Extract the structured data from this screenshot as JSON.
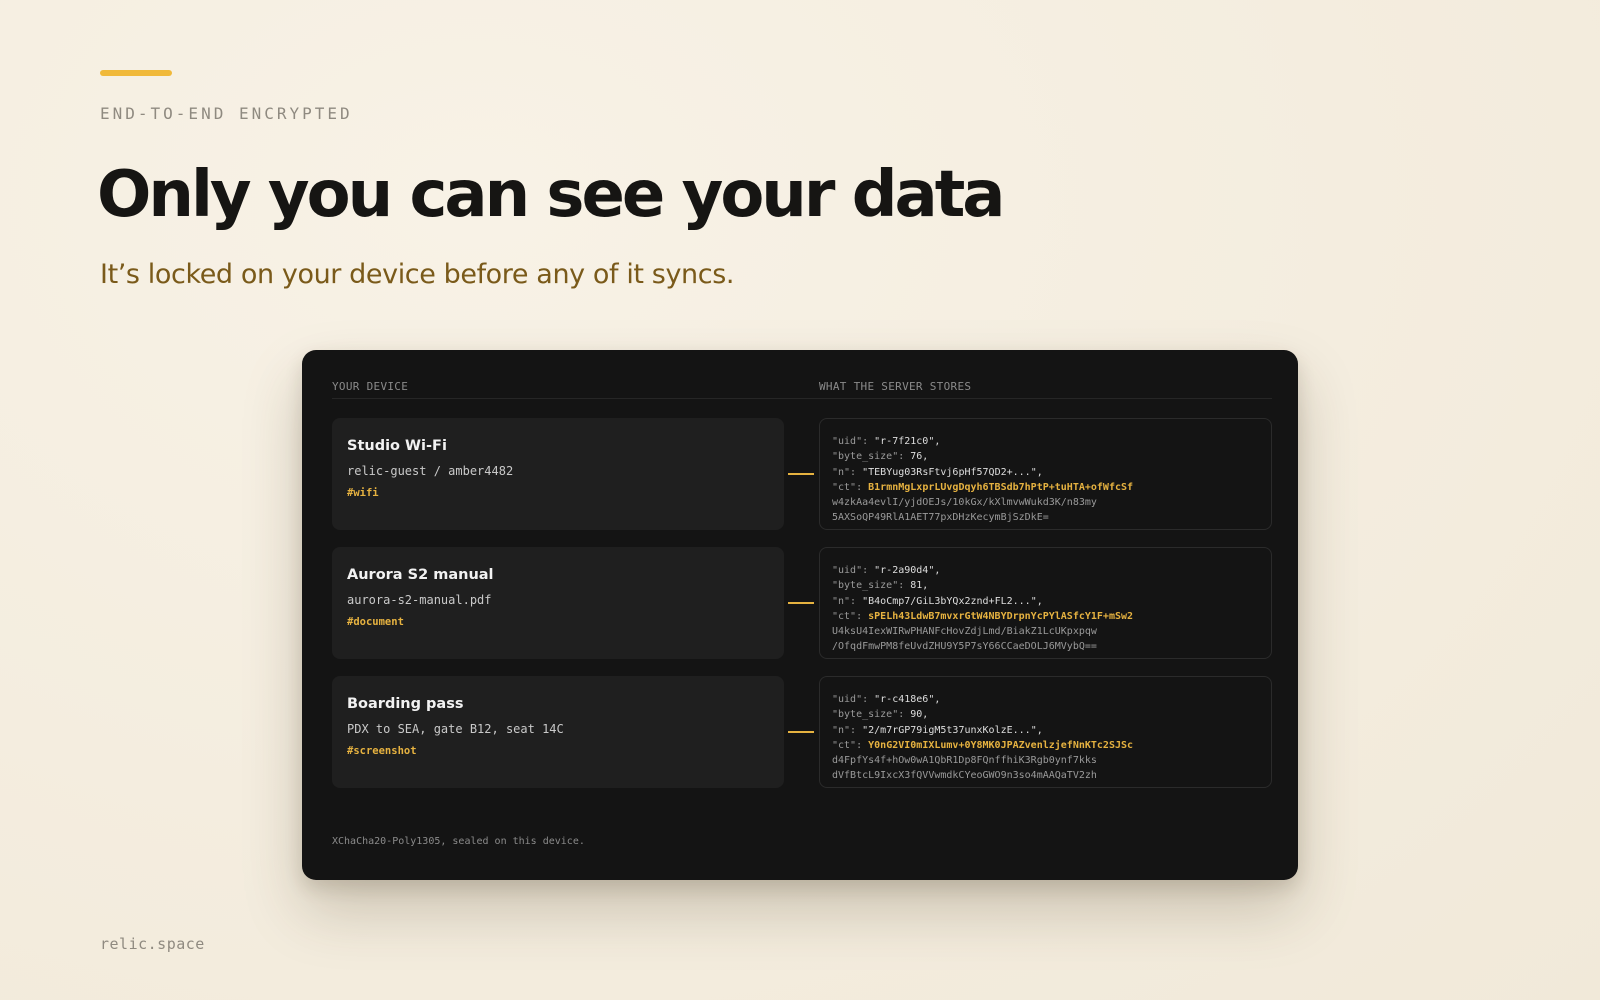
{
  "hero": {
    "eyebrow": "END-TO-END ENCRYPTED",
    "title": "Only you can see your data",
    "subtitle": "It’s locked on your device before any of it syncs."
  },
  "panel": {
    "device_header": "YOUR DEVICE",
    "server_header": "WHAT THE SERVER STORES",
    "footnote": "XChaCha20-Poly1305, sealed on this device."
  },
  "items": [
    {
      "title": "Studio Wi-Fi",
      "detail": "relic-guest / amber4482",
      "tag": "#wifi",
      "server": {
        "uid_key": "\"uid\":",
        "uid_val": " \"r-7f21c0\",",
        "size_key": "\"byte_size\":",
        "size_val": " 76,",
        "n_key": "\"n\":",
        "n_val": " \"TEBYug03RsFtvj6pHf57QD2+...\",",
        "ct_key": "\"ct\":",
        "ct_val": " B1rmnMgLxprLUvgDqyh6TBSdb7hPtP+tuHTA+ofWfcSf",
        "ct_line2": "w4zkAa4evlI/yjdOEJs/10kGx/kXlmvwWukd3K/n83my",
        "ct_line3": "5AXSoQP49RlA1AET77pxDHzKecymBjSzDkE="
      }
    },
    {
      "title": "Aurora S2 manual",
      "detail": "aurora-s2-manual.pdf",
      "tag": "#document",
      "server": {
        "uid_key": "\"uid\":",
        "uid_val": " \"r-2a90d4\",",
        "size_key": "\"byte_size\":",
        "size_val": " 81,",
        "n_key": "\"n\":",
        "n_val": " \"B4oCmp7/GiL3bYQx2znd+FL2...\",",
        "ct_key": "\"ct\":",
        "ct_val": " sPELh43LdwB7mvxrGtW4NBYDrpnYcPYlASfcY1F+mSw2",
        "ct_line2": "U4ksU4IexWIRwPHANFcHovZdjLmd/BiakZ1LcUKpxpqw",
        "ct_line3": "/OfqdFmwPM8feUvdZHU9Y5P7sY66CCaeDOLJ6MVybQ=="
      }
    },
    {
      "title": "Boarding pass",
      "detail": "PDX to SEA, gate B12, seat 14C",
      "tag": "#screenshot",
      "server": {
        "uid_key": "\"uid\":",
        "uid_val": " \"r-c418e6\",",
        "size_key": "\"byte_size\":",
        "size_val": " 90,",
        "n_key": "\"n\":",
        "n_val": " \"2/m7rGP79igM5t37unxKolzE...\",",
        "ct_key": "\"ct\":",
        "ct_val": " Y0nG2VI0mIXLumv+0Y8MK0JPAZvenlzjefNnKTc2SJSc",
        "ct_line2": "d4FpfYs4f+hOw0wA1QbR1Dp8FQnffhiK3Rgb0ynf7kks",
        "ct_line3": "dVfBtcL9IxcX3fQVVwmdkCYeoGWO9n3so4mAAQaTV2zh"
      }
    }
  ],
  "footer": {
    "brand": "relic.space"
  },
  "colors": {
    "accent": "#f0b93a",
    "panel_bg": "#141414",
    "card_bg": "#1f1f1f",
    "subtitle": "#7a5a1a",
    "tag": "#e6b240"
  }
}
